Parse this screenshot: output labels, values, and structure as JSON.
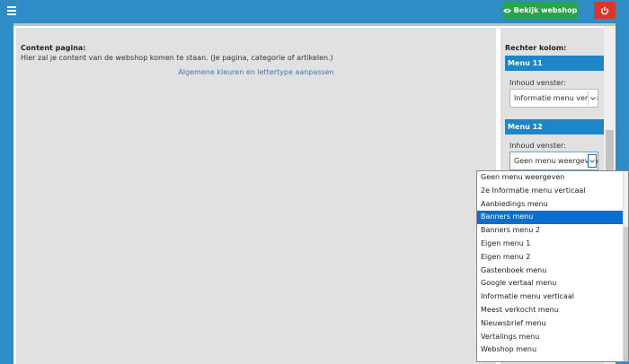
{
  "topbar": {
    "menu_icon": "hamburger-icon",
    "view_button_label": "Bekijk webshop",
    "view_button_icon": "eye-icon",
    "power_icon": "power-icon",
    "colors": {
      "bar": "#2f8cc4",
      "view": "#2aa44a",
      "power": "#d9372b"
    }
  },
  "content": {
    "heading": "Content pagina:",
    "text": "Hier zal je content van de webshop komen te staan. (Je pagina, categorie of artikelen.)",
    "link": "Algemene kleuren en lettertype aanpassen"
  },
  "right_column": {
    "title": "Rechter kolom:",
    "menus": [
      {
        "header": "Menu 11",
        "label": "Inhoud venster:",
        "value": "Informatie menu verticaal"
      },
      {
        "header": "Menu 12",
        "label": "Inhoud venster:",
        "value": "Geen menu weergeven"
      }
    ]
  },
  "dropdown": {
    "selected_index": 3,
    "options": [
      "Geen menu weergeven",
      "2e Informatie menu verticaal",
      "Aanbiedings menu",
      "Banners menu",
      "Banners menu 2",
      "Eigen menu 1",
      "Eigen menu 2",
      "Gastenboek menu",
      "Google vertaal menu",
      "Informatie menu verticaal",
      "Meest verkocht menu",
      "Nieuwsbrief menu",
      "Vertalings menu",
      "Webshop menu"
    ]
  }
}
